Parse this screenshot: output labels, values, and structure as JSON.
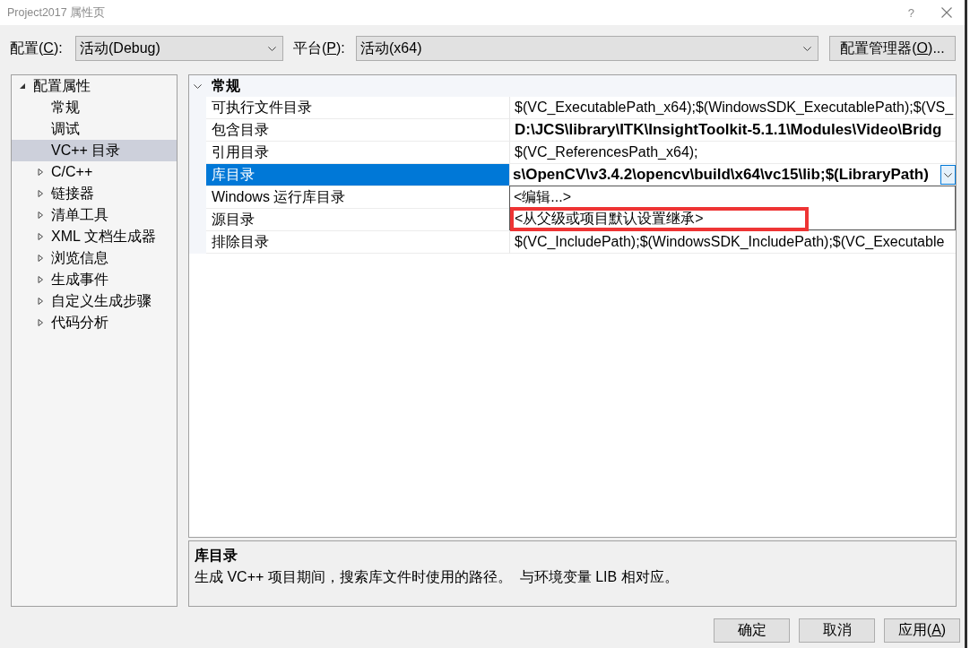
{
  "window": {
    "title": "Project2017 属性页",
    "help": "?"
  },
  "toolbar": {
    "configuration": {
      "label": {
        "text": "配置(",
        "access_key": "C",
        "text_after": "):"
      },
      "value": "活动(Debug)"
    },
    "platform": {
      "label": {
        "text": "平台(",
        "access_key": "P",
        "text_after": "):"
      },
      "value": "活动(x64)"
    },
    "manager_button": {
      "text": "配置管理器(",
      "access_key": "O",
      "text_after": ")..."
    }
  },
  "tree": [
    {
      "label": "配置属性",
      "kind": "category",
      "expanded": true,
      "selected": false,
      "children": [
        {
          "label": "常规",
          "kind": "page",
          "selected": false
        },
        {
          "label": "调试",
          "kind": "page",
          "selected": false
        },
        {
          "label": "VC++ 目录",
          "kind": "page",
          "selected": true
        },
        {
          "label": "C/C++",
          "kind": "category",
          "expanded": false,
          "selected": false
        },
        {
          "label": "链接器",
          "kind": "category",
          "expanded": false,
          "selected": false
        },
        {
          "label": "清单工具",
          "kind": "category",
          "expanded": false,
          "selected": false
        },
        {
          "label": "XML 文档生成器",
          "kind": "category",
          "expanded": false,
          "selected": false
        },
        {
          "label": "浏览信息",
          "kind": "category",
          "expanded": false,
          "selected": false
        },
        {
          "label": "生成事件",
          "kind": "category",
          "expanded": false,
          "selected": false
        },
        {
          "label": "自定义生成步骤",
          "kind": "category",
          "expanded": false,
          "selected": false
        },
        {
          "label": "代码分析",
          "kind": "category",
          "expanded": false,
          "selected": false
        }
      ]
    }
  ],
  "grid": {
    "category": {
      "label": "常规",
      "expanded": true
    },
    "rows": [
      {
        "name": "可执行文件目录",
        "value": "$(VC_ExecutablePath_x64);$(WindowsSDK_ExecutablePath);$(VS_",
        "modified": false,
        "selected": false
      },
      {
        "name": "包含目录",
        "value": "D:\\JCS\\library\\ITK\\InsightToolkit-5.1.1\\Modules\\Video\\Bridg",
        "modified": true,
        "selected": false
      },
      {
        "name": "引用目录",
        "value": "$(VC_ReferencesPath_x64);",
        "modified": false,
        "selected": false
      },
      {
        "name": "库目录",
        "value": "s\\OpenCV\\v3.4.2\\opencv\\build\\x64\\vc15\\lib;$(LibraryPath)",
        "modified": true,
        "selected": true
      },
      {
        "name": "Windows 运行库目录",
        "selected": false
      },
      {
        "name": "源目录",
        "selected": false
      },
      {
        "name": "排除目录",
        "value": "$(VC_IncludePath);$(WindowsSDK_IncludePath);$(VC_Executable",
        "modified": false,
        "selected": false
      }
    ],
    "dropdown": {
      "items": [
        {
          "label": "<编辑...>",
          "annotated": false
        },
        {
          "label": "<从父级或项目默认设置继承>",
          "annotated": true
        }
      ]
    }
  },
  "description": {
    "title": "库目录",
    "text": "生成 VC++ 项目期间，搜索库文件时使用的路径。  与环境变量 LIB 相对应。"
  },
  "buttons": [
    {
      "text": "确定"
    },
    {
      "text": "取消"
    },
    {
      "text": "应用(",
      "access_key": "A",
      "text_after": ")"
    }
  ]
}
